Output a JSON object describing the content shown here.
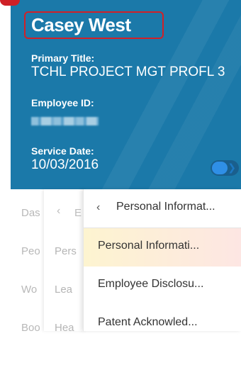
{
  "profile": {
    "name": "Casey West",
    "primary_title_label": "Primary Title:",
    "primary_title_value": "TCHL PROJECT MGT PROFL 3",
    "employee_id_label": "Employee ID:",
    "service_date_label": "Service Date:",
    "service_date_value": "10/03/2016",
    "accent_color": "#1b79a9",
    "highlight_color": "#d22027"
  },
  "menu_level1": {
    "items": [
      "Das",
      "Peo",
      "Wo",
      "Boo"
    ]
  },
  "menu_level2": {
    "back_icon": "chevron-left-icon",
    "header": "E",
    "items": [
      "Pers",
      "Lea",
      "Hea"
    ]
  },
  "menu_level3": {
    "back_icon": "chevron-left-icon",
    "header": "Personal Informat...",
    "items": [
      {
        "label": "Personal Informati...",
        "active": true
      },
      {
        "label": "Employee Disclosu..."
      },
      {
        "label": "Patent Acknowled..."
      }
    ]
  }
}
